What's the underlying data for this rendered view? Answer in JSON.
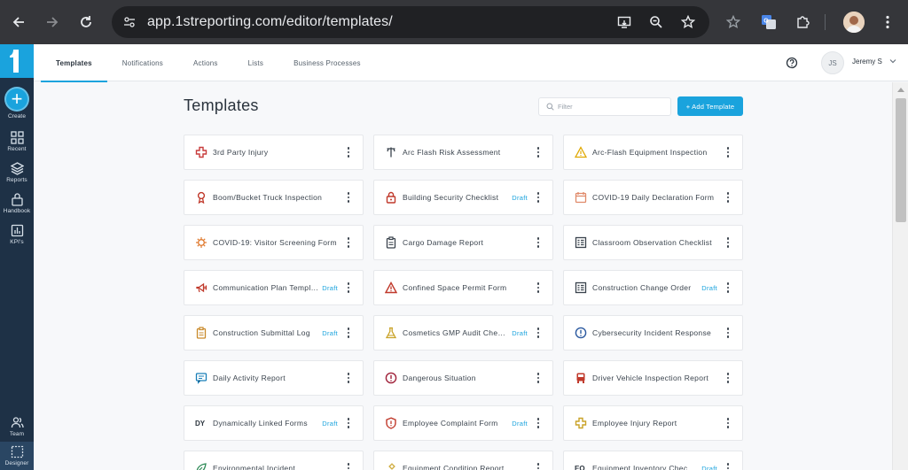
{
  "browser": {
    "url": "app.1streporting.com/editor/templates/",
    "profile_color": "#d9b89a"
  },
  "rail": {
    "create": "Create",
    "recent": "Recent",
    "reports": "Reports",
    "handbook": "Handbook",
    "kpis": "KPI's",
    "team": "Team",
    "designer": "Designer"
  },
  "appbar": {
    "tabs": [
      {
        "label": "Templates",
        "active": true
      },
      {
        "label": "Notifications",
        "active": false
      },
      {
        "label": "Actions",
        "active": false
      },
      {
        "label": "Lists",
        "active": false
      },
      {
        "label": "Business Processes",
        "active": false
      }
    ],
    "user_initials": "JS",
    "user_name": "Jeremy S"
  },
  "main": {
    "title": "Templates",
    "filter_placeholder": "Filter",
    "add_button": "+ Add Template",
    "draft_label": "Draft",
    "accent": "#1aa3dd"
  },
  "templates": [
    {
      "name": "3rd Party Injury",
      "draft": false,
      "icon": "medical-cross-icon",
      "color": "#c73b3b"
    },
    {
      "name": "Arc Flash Risk Assessment",
      "draft": false,
      "icon": "utility-pole-icon",
      "color": "#3a434d"
    },
    {
      "name": "Arc-Flash Equipment Inspection",
      "draft": false,
      "icon": "warning-triangle-icon",
      "color": "#e0a800"
    },
    {
      "name": "Boom/Bucket Truck Inspection",
      "draft": false,
      "icon": "award-icon",
      "color": "#c0392b"
    },
    {
      "name": "Building Security Checklist",
      "draft": true,
      "icon": "lock-icon",
      "color": "#c0392b"
    },
    {
      "name": "COVID-19 Daily Declaration Form",
      "draft": false,
      "icon": "calendar-icon",
      "color": "#e08a6a"
    },
    {
      "name": "COVID-19: Visitor Screening Form",
      "draft": false,
      "icon": "virus-icon",
      "color": "#e07a2f"
    },
    {
      "name": "Cargo Damage Report",
      "draft": false,
      "icon": "clipboard-icon",
      "color": "#3a434d"
    },
    {
      "name": "Classroom Observation Checklist",
      "draft": false,
      "icon": "checklist-icon",
      "color": "#3a434d"
    },
    {
      "name": "Communication Plan Template",
      "draft": true,
      "icon": "megaphone-icon",
      "color": "#c0392b"
    },
    {
      "name": "Confined Space Permit Form",
      "draft": false,
      "icon": "alert-triangle-icon",
      "color": "#c0392b"
    },
    {
      "name": "Construction Change Order",
      "draft": true,
      "icon": "checklist-icon",
      "color": "#3a434d"
    },
    {
      "name": "Construction Submittal Log",
      "draft": true,
      "icon": "clipboard-icon",
      "color": "#c98a2b"
    },
    {
      "name": "Cosmetics GMP Audit Checklist",
      "draft": true,
      "icon": "flask-icon",
      "color": "#c9a227"
    },
    {
      "name": "Cybersecurity Incident Response",
      "draft": false,
      "icon": "info-circle-icon",
      "color": "#2c5aa0"
    },
    {
      "name": "Daily Activity Report",
      "draft": false,
      "icon": "message-icon",
      "color": "#1a7fb8"
    },
    {
      "name": "Dangerous Situation",
      "draft": false,
      "icon": "exclamation-circle-icon",
      "color": "#a0223a"
    },
    {
      "name": "Driver Vehicle Inspection Report",
      "draft": false,
      "icon": "truck-icon",
      "color": "#c0392b"
    },
    {
      "name": "Dynamically Linked Forms",
      "draft": true,
      "icon": "dy-text-icon",
      "color": "#2a333d"
    },
    {
      "name": "Employee Complaint Form",
      "draft": true,
      "icon": "shield-icon",
      "color": "#c0392b"
    },
    {
      "name": "Employee Injury Report",
      "draft": false,
      "icon": "medical-cross-outline-icon",
      "color": "#c9a227"
    },
    {
      "name": "Environmental Incident",
      "draft": false,
      "icon": "leaf-icon",
      "color": "#2e8b57"
    },
    {
      "name": "Equipment Condition Report",
      "draft": false,
      "icon": "gear-hand-icon",
      "color": "#c9a227"
    },
    {
      "name": "Equipment Inventory Checklist",
      "draft": true,
      "icon": "eq-text-icon",
      "color": "#2a333d"
    }
  ]
}
